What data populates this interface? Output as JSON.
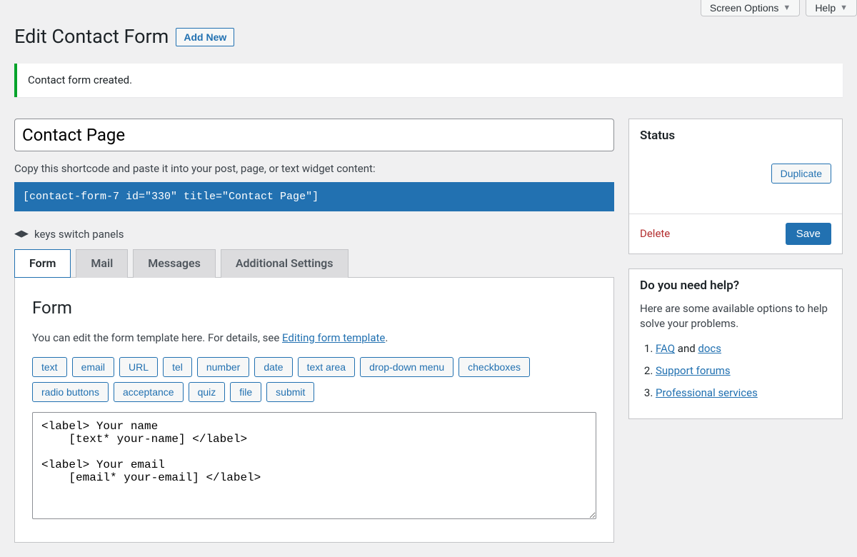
{
  "topButtons": {
    "screenOptions": "Screen Options",
    "help": "Help"
  },
  "header": {
    "title": "Edit Contact Form",
    "addNew": "Add New"
  },
  "notice": "Contact form created.",
  "formTitle": "Contact Page",
  "shortcode": {
    "label": "Copy this shortcode and paste it into your post, page, or text widget content:",
    "value": "[contact-form-7 id=\"330\" title=\"Contact Page\"]"
  },
  "keysHint": "keys switch panels",
  "tabs": [
    "Form",
    "Mail",
    "Messages",
    "Additional Settings"
  ],
  "formPanel": {
    "heading": "Form",
    "descPrefix": "You can edit the form template here. For details, see ",
    "descLink": "Editing form template",
    "tagButtons": [
      "text",
      "email",
      "URL",
      "tel",
      "number",
      "date",
      "text area",
      "drop-down menu",
      "checkboxes",
      "radio buttons",
      "acceptance",
      "quiz",
      "file",
      "submit"
    ],
    "template": "<label> Your name\n    [text* your-name] </label>\n\n<label> Your email\n    [email* your-email] </label>"
  },
  "statusBox": {
    "title": "Status",
    "duplicate": "Duplicate",
    "delete": "Delete",
    "save": "Save"
  },
  "helpBox": {
    "title": "Do you need help?",
    "intro": "Here are some available options to help solve your problems.",
    "items": [
      {
        "linkText": "FAQ",
        "suffix": " and ",
        "linkText2": "docs"
      },
      {
        "linkText": "Support forums"
      },
      {
        "linkText": "Professional services"
      }
    ]
  }
}
